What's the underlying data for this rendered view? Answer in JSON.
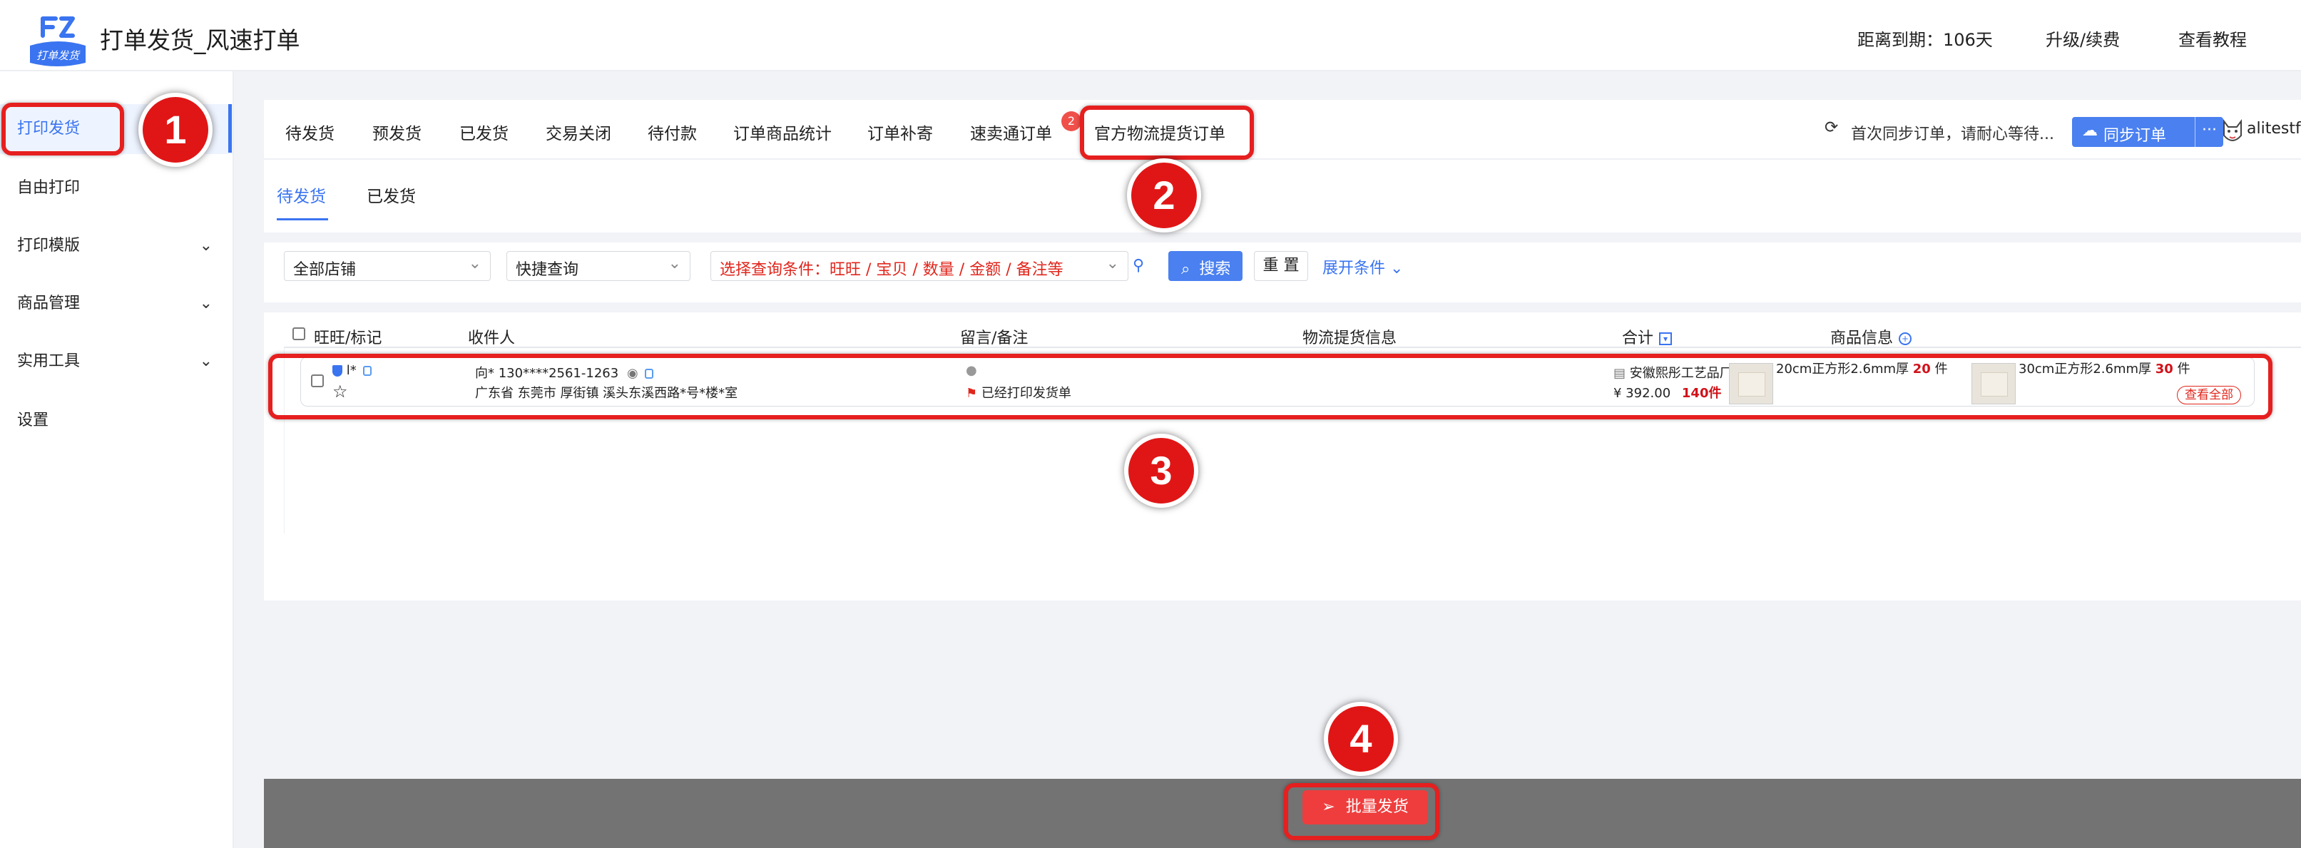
{
  "app": {
    "title": "打单发货_风速打单",
    "logo_text": "打单发货"
  },
  "header": {
    "expiry": "距离到期：106天",
    "upgrade": "升级/续费",
    "tutorial": "查看教程"
  },
  "sidebar": {
    "items": [
      {
        "label": "打印发货"
      },
      {
        "label": "自由打印"
      },
      {
        "label": "打印模版"
      },
      {
        "label": "商品管理"
      },
      {
        "label": "实用工具"
      },
      {
        "label": "设置"
      }
    ]
  },
  "tabs": [
    {
      "label": "待发货"
    },
    {
      "label": "预发货"
    },
    {
      "label": "已发货"
    },
    {
      "label": "交易关闭"
    },
    {
      "label": "待付款"
    },
    {
      "label": "订单商品统计"
    },
    {
      "label": "订单补寄"
    },
    {
      "label": "速卖通订单",
      "badge": "2"
    },
    {
      "label": "官方物流提货订单"
    }
  ],
  "sync": {
    "status": "首次同步订单，请耐心等待...",
    "button": "同步订单",
    "more": "···",
    "account": "alitestfo"
  },
  "subtabs": [
    {
      "label": "待发货"
    },
    {
      "label": "已发货"
    }
  ],
  "filter": {
    "shop": "全部店铺",
    "quick": "快捷查询",
    "condition": "选择查询条件：旺旺 / 宝贝 / 数量 / 金额 / 备注等",
    "search": "搜索",
    "reset": "重 置",
    "expand": "展开条件"
  },
  "table": {
    "headers": {
      "wangwang": "旺旺/标记",
      "receiver": "收件人",
      "remark": "留言/备注",
      "logistics": "物流提货信息",
      "total": "合计",
      "product": "商品信息"
    },
    "row": {
      "buyer": "l*",
      "receiver_line1": "向* 130****2561-1263",
      "receiver_line2": "广东省 东莞市 厚街镇 溪头东溪西路*号*楼*室",
      "remark_status": "已经打印发货单",
      "shop": "安徽熙彤工艺品厂",
      "amount": "¥ 392.00",
      "count": "140件",
      "products": [
        {
          "name": "20cm正方形2.6mm厚",
          "qty": "20",
          "unit": "件"
        },
        {
          "name": "30cm正方形2.6mm厚",
          "qty": "30",
          "unit": "件"
        }
      ],
      "view_all": "查看全部"
    }
  },
  "bottom": {
    "batch_ship": "批量发货"
  },
  "annotations": [
    "1",
    "2",
    "3",
    "4"
  ],
  "colors": {
    "accent": "#3a74f0",
    "annotation": "#e61f1f",
    "danger": "#ef3d3d"
  }
}
